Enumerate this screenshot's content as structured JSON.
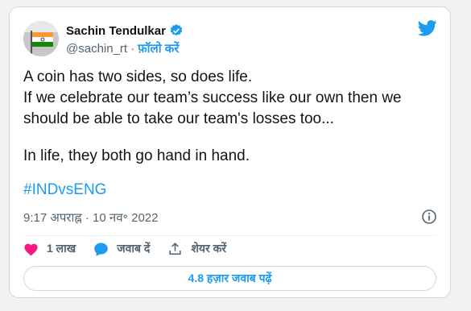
{
  "author": {
    "name": "Sachin Tendulkar",
    "handle": "@sachin_rt",
    "separator": "·",
    "follow_label": "फ़ॉलो करें"
  },
  "tweet": {
    "line1": "A coin has two sides, so does life.",
    "line2": "If we celebrate our team’s success like our own then we should be able to take our team's losses too...",
    "line3": "In life, they both go hand in hand.",
    "hashtag": "#INDvsENG",
    "timestamp": "9:17 अपराह्न · 10 नव॰ 2022"
  },
  "actions": {
    "likes": "1 लाख",
    "reply_label": "जवाब दें",
    "share_label": "शेयर करें"
  },
  "read_replies_label": "4.8 हज़ार जवाब पढ़ें",
  "colors": {
    "accent": "#1d9bf0",
    "like": "#f91880",
    "text": "#0f1419",
    "muted": "#536471"
  }
}
